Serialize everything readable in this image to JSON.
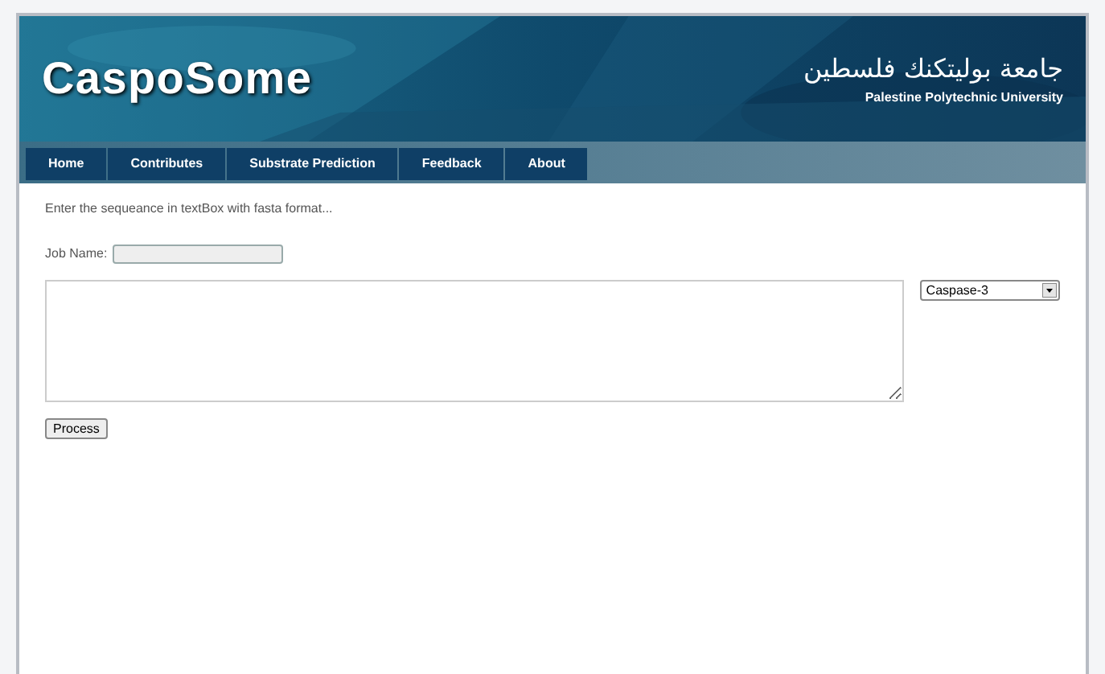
{
  "header": {
    "logo": "CaspoSome",
    "university_arabic": "جامعة بوليتكنك فلسطين",
    "university": "Palestine Polytechnic University"
  },
  "nav": [
    {
      "label": "Home"
    },
    {
      "label": "Contributes"
    },
    {
      "label": "Substrate Prediction"
    },
    {
      "label": "Feedback"
    },
    {
      "label": "About"
    }
  ],
  "form": {
    "instruction": "Enter the sequeance in textBox with fasta format...",
    "job_name_label": "Job Name:",
    "caspase_select": "Caspase-3",
    "process_button": "Process"
  }
}
